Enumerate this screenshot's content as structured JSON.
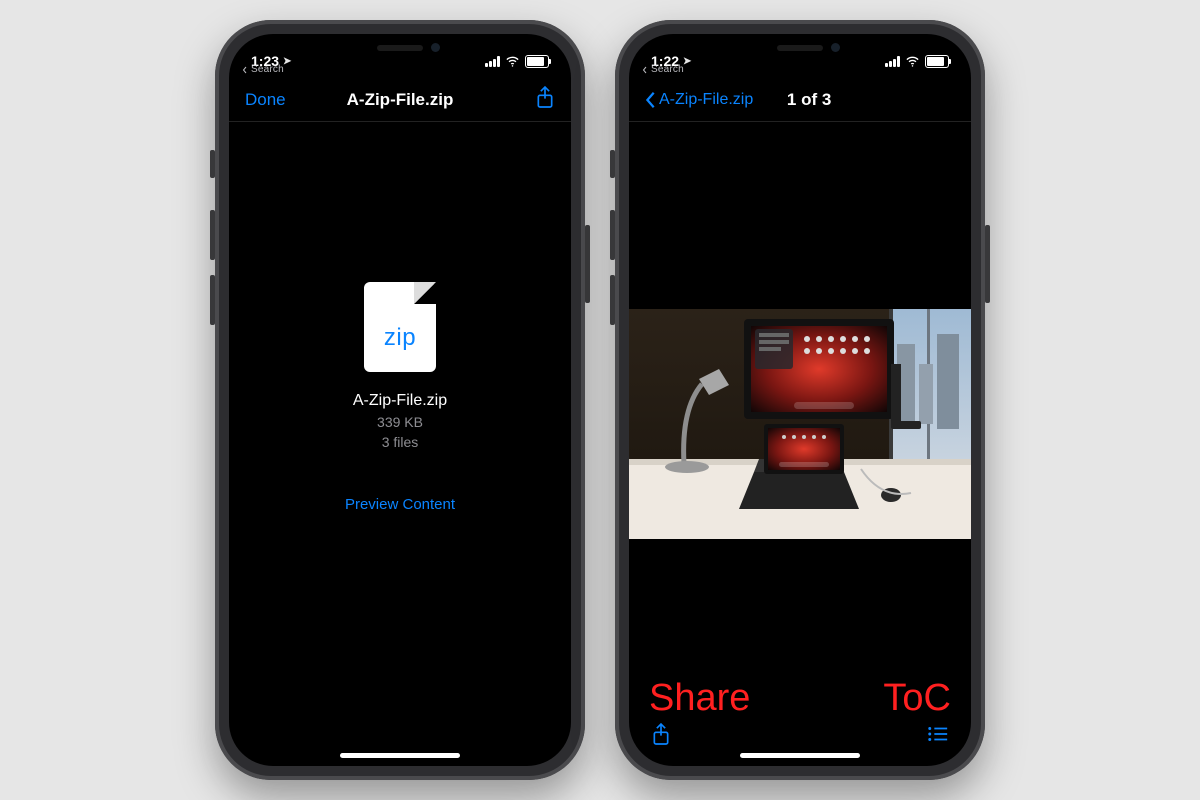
{
  "left": {
    "status": {
      "time": "1:23",
      "back_mini": "Search"
    },
    "nav": {
      "left_label": "Done",
      "title": "A-Zip-File.zip"
    },
    "file": {
      "type_label": "zip",
      "name": "A-Zip-File.zip",
      "size": "339 KB",
      "count": "3 files"
    },
    "preview_button": "Preview Content"
  },
  "right": {
    "status": {
      "time": "1:22",
      "back_mini": "Search"
    },
    "nav": {
      "back_label": "A-Zip-File.zip",
      "title": "1 of 3"
    },
    "annotations": {
      "share": "Share",
      "toc": "ToC"
    }
  }
}
